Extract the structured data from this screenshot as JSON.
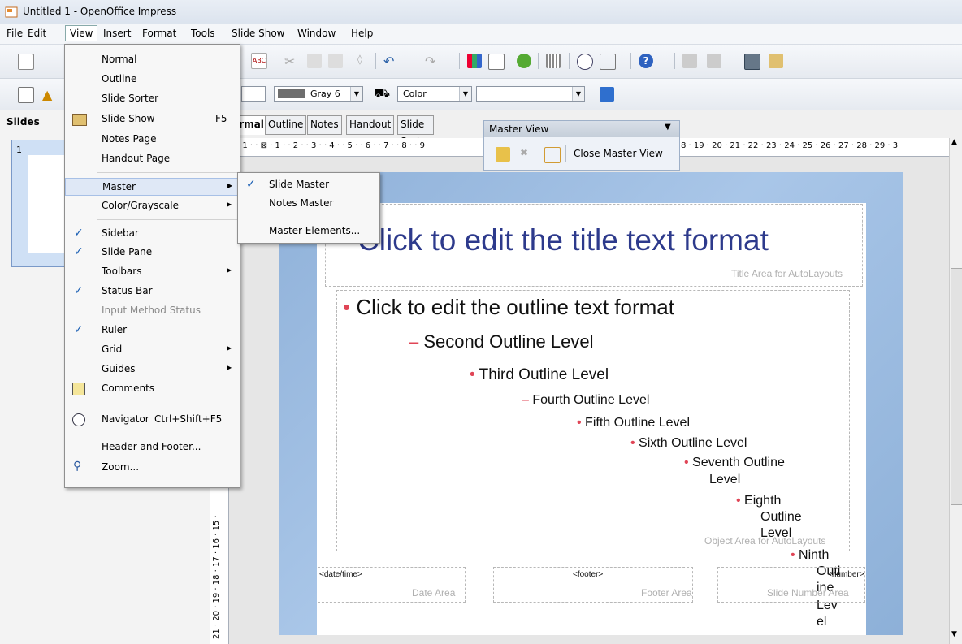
{
  "window": {
    "title": "Untitled 1 - OpenOffice Impress"
  },
  "menubar": {
    "items": [
      "File",
      "Edit",
      "View",
      "Insert",
      "Format",
      "Tools",
      "Slide Show",
      "Window",
      "Help"
    ]
  },
  "toolbar2": {
    "color_value": "Gray 6",
    "color_mode": "Color"
  },
  "slides_pane": {
    "title": "Slides",
    "slide_number": "1"
  },
  "tabs": [
    "Normal",
    "Outline",
    "Notes",
    "Handout",
    "Slide Sorter"
  ],
  "ruler_text": "· 1 · · ⊠ · 1 · · 2 · · 3 · · 4 · · 5 · · 6 · · 7 · · 8 · · 9",
  "ruler_text_right": "8 · 19 · 20 · 21 · 22 · 23 · 24 · 25 · 26 · 27 · 28 · 29 · 3",
  "vruler_text": "21 · 20 · 19 · 18 · 17 · 16 · 15 ·",
  "master_view": {
    "title": "Master View",
    "close_label": "Close Master View"
  },
  "view_menu": [
    {
      "label": "Normal"
    },
    {
      "label": "Outline"
    },
    {
      "label": "Slide Sorter"
    },
    {
      "label": "Slide Show",
      "shortcut": "F5"
    },
    {
      "label": "Notes Page"
    },
    {
      "label": "Handout Page"
    },
    {
      "label": "Master"
    },
    {
      "label": "Color/Grayscale"
    },
    {
      "label": "Sidebar"
    },
    {
      "label": "Slide Pane"
    },
    {
      "label": "Toolbars"
    },
    {
      "label": "Status Bar"
    },
    {
      "label": "Input Method Status"
    },
    {
      "label": "Ruler"
    },
    {
      "label": "Grid"
    },
    {
      "label": "Guides"
    },
    {
      "label": "Comments"
    },
    {
      "label": "Navigator",
      "shortcut": "Ctrl+Shift+F5"
    },
    {
      "label": "Header and Footer..."
    },
    {
      "label": "Zoom..."
    }
  ],
  "master_submenu": [
    "Slide Master",
    "Notes Master",
    "Master Elements..."
  ],
  "slide": {
    "title": "Click to edit the title text format",
    "title_area_label": "Title Area for AutoLayouts",
    "object_area_label": "Object Area for AutoLayouts",
    "outline": [
      "Click to edit the outline text format",
      "Second Outline Level",
      "Third Outline Level",
      "Fourth Outline Level",
      "Fifth Outline Level",
      "Sixth Outline Level",
      "Seventh Outline",
      "Level",
      "Eighth",
      "Outline",
      "Level",
      "Ninth",
      "Outl",
      "ine",
      "Lev",
      "el"
    ],
    "date_field": "<date/time>",
    "date_label": "Date Area",
    "footer_field": "<footer>",
    "footer_label": "Footer Area",
    "number_field": "<number>",
    "number_label": "Slide Number Area"
  }
}
